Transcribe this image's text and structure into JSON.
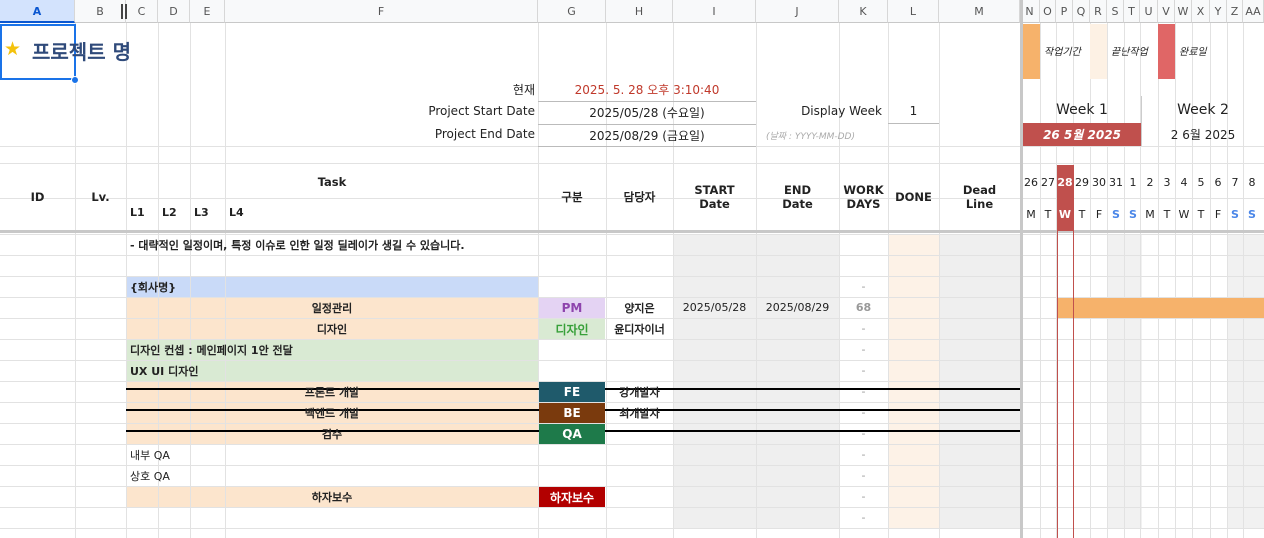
{
  "columns": [
    "A",
    "B",
    "C",
    "D",
    "E",
    "F",
    "G",
    "H",
    "I",
    "J",
    "K",
    "L",
    "M",
    "N",
    "O",
    "P",
    "Q",
    "R",
    "S",
    "T",
    "U",
    "V",
    "W",
    "X",
    "Y",
    "Z",
    "AA"
  ],
  "title": "프로젝트 명",
  "info": {
    "now_label": "현재",
    "now_value": "2025. 5. 28 오후 3:10:40",
    "start_label": "Project Start Date",
    "start_value": "2025/05/28 (수요일)",
    "end_label": "Project End Date",
    "end_value": "2025/08/29 (금요일)",
    "date_hint": "(날짜 : YYYY-MM-DD)",
    "display_week_label": "Display Week",
    "display_week_value": "1"
  },
  "legend": [
    {
      "label": "작업기간",
      "color": "#f6b26b"
    },
    {
      "label": "끝난작업",
      "color": "#fdf1e4"
    },
    {
      "label": "완료일",
      "color": "#e06666"
    }
  ],
  "weeks": [
    {
      "label": "Week 1",
      "date": "26 5월 2025",
      "highlight": true
    },
    {
      "label": "Week 2",
      "date": "2 6월 2025",
      "highlight": false
    }
  ],
  "days": [
    {
      "num": "26",
      "dow": "M"
    },
    {
      "num": "27",
      "dow": "T"
    },
    {
      "num": "28",
      "dow": "W"
    },
    {
      "num": "29",
      "dow": "T"
    },
    {
      "num": "30",
      "dow": "F"
    },
    {
      "num": "31",
      "dow": "S"
    },
    {
      "num": "1",
      "dow": "S"
    },
    {
      "num": "2",
      "dow": "M"
    },
    {
      "num": "3",
      "dow": "T"
    },
    {
      "num": "4",
      "dow": "W"
    },
    {
      "num": "5",
      "dow": "T"
    },
    {
      "num": "6",
      "dow": "F"
    },
    {
      "num": "7",
      "dow": "S"
    },
    {
      "num": "8",
      "dow": "S"
    }
  ],
  "header": {
    "id": "ID",
    "lv": "Lv.",
    "task": "Task",
    "l1": "L1",
    "l2": "L2",
    "l3": "L3",
    "l4": "L4",
    "gubun": "구분",
    "owner": "담당자",
    "start": "START\nDate",
    "end": "END\nDate",
    "workdays": "WORK\nDAYS",
    "done": "DONE",
    "deadline": "Dead\nLine"
  },
  "rows": [
    {
      "style": "note",
      "task": "- 대략적인 일정이며, 특정 이슈로 인한 일정 딜레이가 생길 수 있습니다.",
      "tag": "",
      "owner": "",
      "start": "",
      "end": "",
      "workdays": ""
    },
    {
      "style": "blank",
      "task": "",
      "tag": "",
      "owner": "",
      "start": "",
      "end": "",
      "workdays": ""
    },
    {
      "style": "company",
      "task": "{회사명}",
      "tag": "",
      "owner": "",
      "start": "",
      "end": "",
      "workdays": "-"
    },
    {
      "style": "peach",
      "task": "일정관리",
      "tag": "PM",
      "owner": "양지은",
      "start": "2025/05/28",
      "end": "2025/08/29",
      "workdays": "68"
    },
    {
      "style": "peach",
      "task": "디자인",
      "tag": "디자인",
      "owner": "윤디자이너",
      "start": "",
      "end": "",
      "workdays": "-"
    },
    {
      "style": "green",
      "task": "디자인 컨셉 : 메인페이지 1안 전달",
      "tag": "",
      "owner": "",
      "start": "",
      "end": "",
      "workdays": "-"
    },
    {
      "style": "green",
      "task": "UX UI 디자인",
      "tag": "",
      "owner": "",
      "start": "",
      "end": "",
      "workdays": "-"
    },
    {
      "style": "peach",
      "task": "프론트 개발",
      "tag": "FE",
      "owner": "강개발자",
      "start": "",
      "end": "",
      "workdays": "-"
    },
    {
      "style": "peach",
      "task": "백엔드 개발",
      "tag": "BE",
      "owner": "최개발자",
      "start": "",
      "end": "",
      "workdays": "-"
    },
    {
      "style": "peach",
      "task": "검수",
      "tag": "QA",
      "owner": "",
      "start": "",
      "end": "",
      "workdays": "-"
    },
    {
      "style": "sub",
      "task": "내부 QA",
      "tag": "",
      "owner": "",
      "start": "",
      "end": "",
      "workdays": "-"
    },
    {
      "style": "sub",
      "task": "상호 QA",
      "tag": "",
      "owner": "",
      "start": "",
      "end": "",
      "workdays": "-"
    },
    {
      "style": "peach",
      "task": "하자보수",
      "tag": "하자보수",
      "owner": "",
      "start": "",
      "end": "",
      "workdays": "-"
    },
    {
      "style": "blank",
      "task": "",
      "tag": "",
      "owner": "",
      "start": "",
      "end": "",
      "workdays": "-"
    }
  ],
  "tag_styles": {
    "PM": {
      "bg": "#e4d3f3",
      "fg": "#8e44ad"
    },
    "디자인": {
      "bg": "#d9ead3",
      "fg": "#38a03a"
    },
    "FE": {
      "bg": "#1f5a6b",
      "fg": "#ffffff"
    },
    "BE": {
      "bg": "#7a3a0d",
      "fg": "#ffffff"
    },
    "QA": {
      "bg": "#1e7a4a",
      "fg": "#ffffff"
    },
    "하자보수": {
      "bg": "#b20000",
      "fg": "#ffffff"
    }
  },
  "colors": {
    "peach": "#fce5cd",
    "green": "#d9ead3",
    "company": "#c9daf8",
    "grey_cols": "#efefef",
    "done_col": "#fdf2e7",
    "gantt_bar": "#f6b26b",
    "today": "#c0504d",
    "weekend": "#4a86e8",
    "title": "#2f4a7a"
  }
}
